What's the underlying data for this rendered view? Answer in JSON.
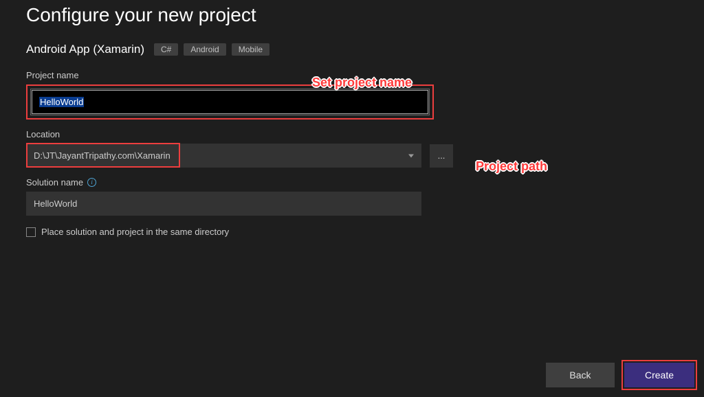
{
  "title": "Configure your new project",
  "subtitle": "Android App (Xamarin)",
  "tags": [
    "C#",
    "Android",
    "Mobile"
  ],
  "fields": {
    "project_name": {
      "label": "Project name",
      "value": "HelloWorld"
    },
    "location": {
      "label": "Location",
      "value": "D:\\JT\\JayantTripathy.com\\Xamarin",
      "browse": "..."
    },
    "solution_name": {
      "label": "Solution name",
      "value": "HelloWorld"
    }
  },
  "checkbox": {
    "label": "Place solution and project in the same directory",
    "checked": false
  },
  "buttons": {
    "back": "Back",
    "create": "Create"
  },
  "annotations": {
    "set_project_name": "Set project name",
    "project_path": "Project path"
  }
}
